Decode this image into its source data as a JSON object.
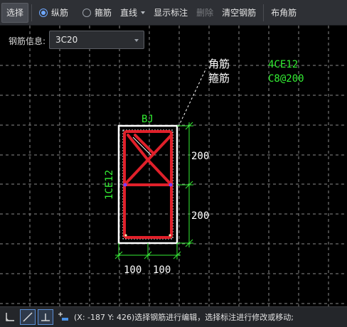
{
  "toolbar": {
    "select_label": "选择",
    "radio_longitudinal_label": "纵筋",
    "radio_stirrup_label": "箍筋",
    "line_label": "直线",
    "show_annotation_label": "显示标注",
    "delete_label": "删除",
    "clear_rebar_label": "清空钢筋",
    "place_corner_label": "布角筋",
    "selected_mode": "纵筋"
  },
  "rebar_info": {
    "label": "钢筋信息:",
    "value": "3C20"
  },
  "drawing": {
    "section_label": "BJ",
    "corner_rebar_label": "角筋",
    "corner_rebar_value": "4CE12",
    "stirrup_label": "箍筋",
    "stirrup_value": "C8@200",
    "side_rebar_label": "1CE12",
    "dim_right_top": "200",
    "dim_right_bottom": "200",
    "dim_bottom_left": "100",
    "dim_bottom_right": "100"
  },
  "colors": {
    "background": "#000000",
    "grid": "#8a8a8a",
    "section_outline": "#ffffff",
    "rebar": "#e0202a",
    "dimension": "#33ee33",
    "annotation_text": "#ffffff",
    "annotation_value": "#33ee33",
    "rebar_node": "#7c3cff"
  },
  "status": {
    "text": "(X: -187 Y: 426)选择钢筋进行编辑，选择标注进行修改或移动;"
  },
  "statusbar_icons": [
    "orthogonal-mode-icon",
    "oblique-line-icon",
    "perpendicular-icon",
    "add-rebar-icon"
  ]
}
